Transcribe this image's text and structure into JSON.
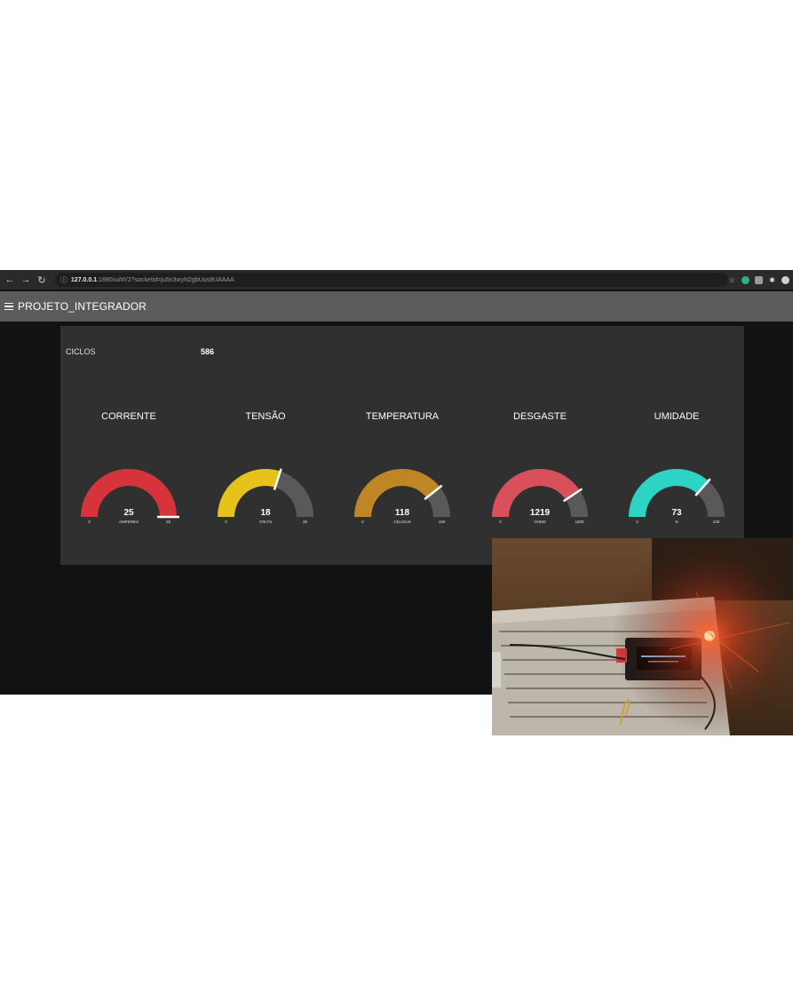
{
  "browser": {
    "url_host": "127.0.0.1",
    "url_path": ":1880/ui/#!/2?socketid=ju5n3wyN2gbUus9UAAAA"
  },
  "header": {
    "title": "PROJETO_INTEGRADOR"
  },
  "ciclos": {
    "label": "CICLOS",
    "value": "586"
  },
  "gauges": [
    {
      "title": "CORRENTE",
      "value": 25,
      "min": 0,
      "max": 25,
      "unit": "AMPERES",
      "color": "#d6343a"
    },
    {
      "title": "TENSÃO",
      "value": 18,
      "min": 0,
      "max": 30,
      "unit": "VOLTS",
      "color": "#e6c21c"
    },
    {
      "title": "TEMPERATURA",
      "value": 118,
      "min": 0,
      "max": 150,
      "unit": "CELSIUS",
      "color": "#c08524"
    },
    {
      "title": "DESGASTE",
      "value": 1219,
      "min": 0,
      "max": 1500,
      "unit": "OHMS",
      "color": "#d9505a"
    },
    {
      "title": "UMIDADE",
      "value": 73,
      "min": 0,
      "max": 100,
      "unit": "%",
      "color": "#2dd4c4"
    }
  ],
  "colors": {
    "track": "#595959",
    "card": "#303031",
    "header": "#5b5b5d",
    "background": "#121212"
  }
}
